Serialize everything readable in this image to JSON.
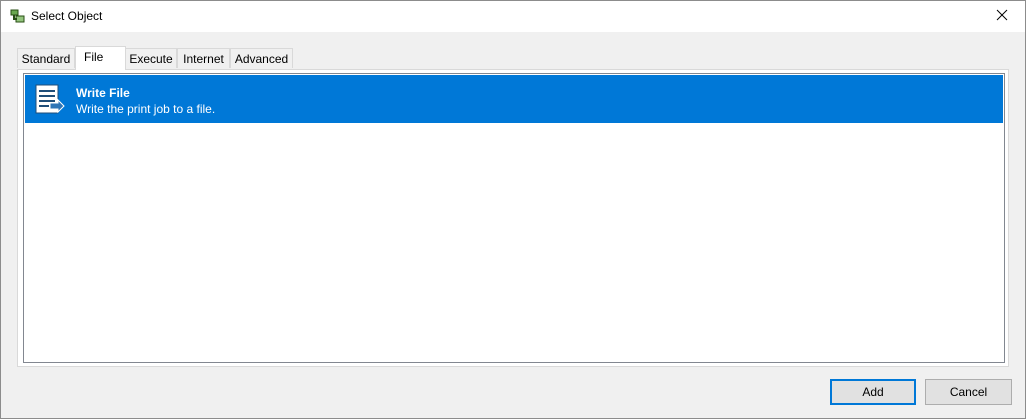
{
  "window": {
    "title": "Select Object",
    "icon": "select-object-icon",
    "close_icon": "close-icon"
  },
  "tabs": [
    {
      "label": "Standard",
      "active": false
    },
    {
      "label": "File",
      "active": true
    },
    {
      "label": "Execute",
      "active": false
    },
    {
      "label": "Internet",
      "active": false
    },
    {
      "label": "Advanced",
      "active": false
    }
  ],
  "list": {
    "items": [
      {
        "title": "Write File",
        "description": "Write the print job to a file.",
        "icon": "write-file-icon",
        "selected": true
      }
    ]
  },
  "buttons": {
    "add_label": "Add",
    "cancel_label": "Cancel"
  },
  "colors": {
    "selection": "#0078d7",
    "window_bg": "#f0f0f0",
    "titlebar_bg": "#ffffff"
  }
}
